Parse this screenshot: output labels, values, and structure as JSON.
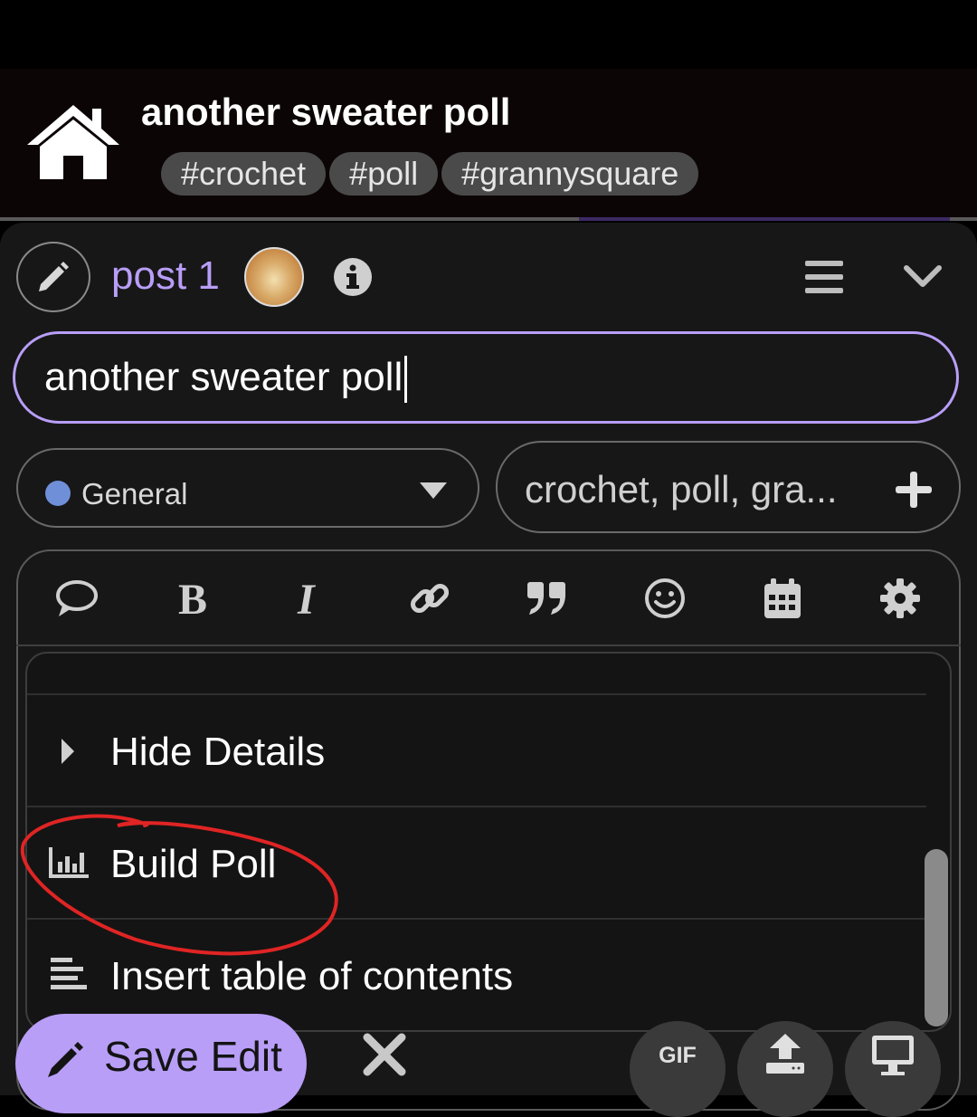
{
  "header": {
    "topic_title": "another sweater poll",
    "tags": [
      "#crochet",
      "#poll",
      "#grannysquare"
    ]
  },
  "composer": {
    "post_label": "post 1",
    "title_value": "another sweater poll",
    "category": {
      "label": "General",
      "color": "#6f8fd8"
    },
    "tags_value": "crochet, poll, gra...",
    "toolbar": [
      "speech-bubble-icon",
      "bold-icon",
      "italic-icon",
      "link-icon",
      "quote-icon",
      "emoji-icon",
      "calendar-icon",
      "gear-icon"
    ],
    "popup_menu": {
      "items": [
        {
          "label": "Hide Details",
          "icon": "caret-right-icon"
        },
        {
          "label": "Build Poll",
          "icon": "bar-chart-icon"
        },
        {
          "label": "Insert table of contents",
          "icon": "align-left-icon"
        }
      ]
    },
    "footer": {
      "save_label": "Save Edit",
      "gif_label": "GIF"
    }
  },
  "colors": {
    "accent": "#b89ef7",
    "background": "#171717",
    "annotation": "#e02424"
  }
}
